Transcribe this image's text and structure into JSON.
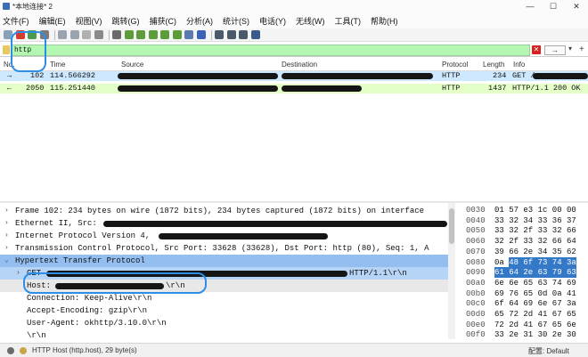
{
  "window": {
    "title": "*本地连接* 2",
    "min": "—",
    "max": "☐",
    "close": "✕"
  },
  "menu": [
    "文件(F)",
    "编辑(E)",
    "视图(V)",
    "跳转(G)",
    "捕获(C)",
    "分析(A)",
    "统计(S)",
    "电话(Y)",
    "无线(W)",
    "工具(T)",
    "帮助(H)"
  ],
  "toolbar": {
    "icons": [
      "shark-fin-icon",
      "stop-capture-icon",
      "restart-capture-icon",
      "capture-options-icon",
      "open-file-icon",
      "save-file-icon",
      "close-file-icon",
      "reload-icon",
      "find-packet-icon",
      "go-back-icon",
      "go-forward-icon",
      "go-to-packet-icon",
      "go-first-icon",
      "go-last-icon",
      "autoscroll-icon",
      "colorize-icon",
      "zoom-in-icon",
      "zoom-out-icon",
      "zoom-normal-icon",
      "resize-columns-icon"
    ],
    "colors": [
      "#8aa0b8",
      "#d43c2c",
      "#4f9a4a",
      "#7a7a7a",
      "#9aa4ae",
      "#9aa4ae",
      "#b0b0b0",
      "#8a8a8a",
      "#6a6a6a",
      "#5d9c3a",
      "#5d9c3a",
      "#5d9c3a",
      "#5d9c3a",
      "#5d9c3a",
      "#5a7ab0",
      "#3a63b8",
      "#4a5a6a",
      "#4a5a6a",
      "#4a5a6a",
      "#3a5a8a"
    ]
  },
  "filter": {
    "value": "http",
    "clear": "✕",
    "apply": "→",
    "dropdown": "▾",
    "add": "+"
  },
  "columns": {
    "no": "No.",
    "time": "Time",
    "source": "Source",
    "destination": "Destination",
    "protocol": "Protocol",
    "length": "Length",
    "info": "Info"
  },
  "packets": [
    {
      "arrow": "→",
      "no": "102",
      "time": "114.566292",
      "protocol": "HTTP",
      "length": "234",
      "info": "GET / ..."
    },
    {
      "arrow": "←",
      "no": "2050",
      "time": "115.251440",
      "protocol": "HTTP",
      "length": "1437",
      "info": "HTTP/1.1 200 OK"
    }
  ],
  "details": [
    {
      "arrow": "›",
      "text": "Frame 102: 234 bytes on wire (1872 bits), 234 bytes captured (1872 bits) on interface"
    },
    {
      "arrow": "›",
      "text": "Ethernet II, Src:"
    },
    {
      "arrow": "›",
      "text": "Internet Protocol Version 4,"
    },
    {
      "arrow": "›",
      "text": "Transmission Control Protocol, Src Port: 33628 (33628), Dst Port: http (80), Seq: 1, A"
    },
    {
      "arrow": "⌄",
      "text": "Hypertext Transfer Protocol"
    },
    {
      "arrow": "›",
      "text": "GET"
    },
    {
      "arrow": "",
      "text": "Host:"
    },
    {
      "arrow": "",
      "text": "Connection: Keep-Alive\\r\\n"
    },
    {
      "arrow": "",
      "text": "Accept-Encoding: gzip\\r\\n"
    },
    {
      "arrow": "",
      "text": "User-Agent: okhttp/3.10.0\\r\\n"
    },
    {
      "arrow": "",
      "text": "\\r\\n"
    }
  ],
  "details_suffix": {
    "get_end": "HTTP/1.1\\r\\n",
    "host_end": "\\r\\n"
  },
  "hex": [
    {
      "off": "0030",
      "bytes": "01 57 e3 1c 00 00"
    },
    {
      "off": "0040",
      "bytes": "33 32 34 33 36 37"
    },
    {
      "off": "0050",
      "bytes": "33 32 2f 33 32 66"
    },
    {
      "off": "0060",
      "bytes": "32 2f 33 32 66 64"
    },
    {
      "off": "0070",
      "bytes": "39 66 2e 34 35 62"
    },
    {
      "off": "0080",
      "bytes": "0a 48 6f 73 74 3a"
    },
    {
      "off": "0090",
      "bytes": "61 64 2e 63 79 63"
    },
    {
      "off": "00a0",
      "bytes": "6e 6e 65 63 74 69"
    },
    {
      "off": "00b0",
      "bytes": "69 76 65 0d 0a 41"
    },
    {
      "off": "00c0",
      "bytes": "6f 64 69 6e 67 3a"
    },
    {
      "off": "00d0",
      "bytes": "65 72 2d 41 67 65"
    },
    {
      "off": "00e0",
      "bytes": "72 2d 41 67 65 6e"
    },
    {
      "off": "00f0",
      "bytes": "33 2e 31 30 2e 30"
    }
  ],
  "hex_sel": {
    "row5": "48 6f 73 74 3a",
    "row6": "61 64 2e 63 79 63"
  },
  "status": {
    "field": "HTTP Host (http.host), 29 byte(s)",
    "profile": "配置: Default"
  },
  "colors": {
    "row_http": "#e4ffc7",
    "row_selected": "#cde8ff",
    "section_selected": "#94bef0",
    "sub_selected": "#b6d4f6",
    "annotation": "#2c8ee6"
  }
}
